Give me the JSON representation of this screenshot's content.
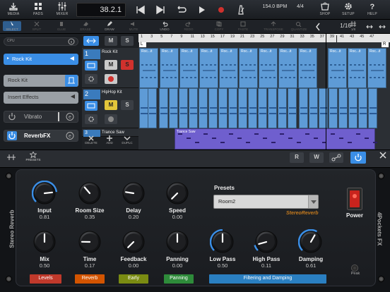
{
  "toolbar": {
    "media": "MEDIA",
    "pads": "PADS",
    "mixer": "MIXER",
    "time": "38.2.1",
    "bpm": "154.0 BPM",
    "meter": "4/4",
    "shop": "SHOP",
    "setup": "SETUP",
    "help": "HELP"
  },
  "editbar": {
    "select": "SELECT",
    "split": "SPLIT",
    "glue": "GLUE",
    "erase": "ERASE",
    "draw": "DRAW",
    "mute": "MUTE",
    "undo": "UNDO",
    "redo": "REDO",
    "copy": "COPY",
    "paste": "PASTE",
    "transpose": "TRANSPOSE",
    "quantize": "QUANTIZE",
    "quantize_value": "1/16",
    "grid_label": "1/8"
  },
  "left_panel": {
    "cpu_label": "CPU",
    "instrument": "Rock Kit",
    "instrument_slot": "Rock Kit",
    "insert_effects": "Insert Effects",
    "fx1": "Vibrato",
    "fx2": "ReverbFX"
  },
  "tracks": [
    {
      "num": "1",
      "name": "Rock Kit"
    },
    {
      "num": "2",
      "name": "HipHop Kit"
    },
    {
      "num": "3",
      "name": "Trance Saw"
    }
  ],
  "track_tools": {
    "delete": "DELETE",
    "add": "ADD",
    "duplicate": "DUPLC"
  },
  "ruler": {
    "numbers": [
      "1",
      "3",
      "5",
      "7",
      "9",
      "11",
      "13",
      "15",
      "17",
      "19",
      "21",
      "23",
      "25",
      "27",
      "29",
      "31",
      "33",
      "35",
      "37",
      "39",
      "41",
      "43",
      "45",
      "47"
    ],
    "left_marker": "L",
    "right_marker": "R"
  },
  "clip_labels": {
    "rock": "Roc...it",
    "trance": "Trance Saw"
  },
  "fx_strip": {
    "presets": "PRESETS",
    "r": "R",
    "w": "W"
  },
  "plugin": {
    "side_left": "Stereo Reverb",
    "side_right": "4Pockets FX",
    "logo": "StereoReverb",
    "presets_label": "Presets",
    "preset_value": "Room2",
    "power_label": "Power",
    "peak_label": "Peak",
    "knobs_top": [
      {
        "label": "Input",
        "value": "0.81",
        "level": 0.81
      },
      {
        "label": "Room Size",
        "value": "0.35",
        "level": 0.35
      },
      {
        "label": "Delay",
        "value": "0.20",
        "level": 0.2
      },
      {
        "label": "Speed",
        "value": "0.00",
        "level": 0.0
      }
    ],
    "knobs_bottom": [
      {
        "label": "Mix",
        "value": "0.50",
        "level": 0.5
      },
      {
        "label": "Time",
        "value": "0.17",
        "level": 0.17
      },
      {
        "label": "Feedback",
        "value": "0.00",
        "level": 0.0
      },
      {
        "label": "Panning",
        "value": "0.00",
        "level": 0.5
      },
      {
        "label": "Low Pass",
        "value": "0.50",
        "level": 0.5
      },
      {
        "label": "High Pass",
        "value": "0.11",
        "level": 0.11
      },
      {
        "label": "Damping",
        "value": "0.61",
        "level": 0.61
      }
    ],
    "categories": [
      {
        "label": "Levels",
        "color": "#c0392b"
      },
      {
        "label": "Reverb",
        "color": "#d35400"
      },
      {
        "label": "Early",
        "color": "#7a8b12"
      },
      {
        "label": "Panning",
        "color": "#2e8b3a"
      },
      {
        "label": "Filtering and Damping",
        "color": "#2a7fc1"
      }
    ]
  },
  "colors": {
    "accent_blue": "#3a8ee6",
    "record_red": "#d0312d",
    "clip_blue": "#5e9bd6",
    "clip_purple": "#6f5fce"
  }
}
